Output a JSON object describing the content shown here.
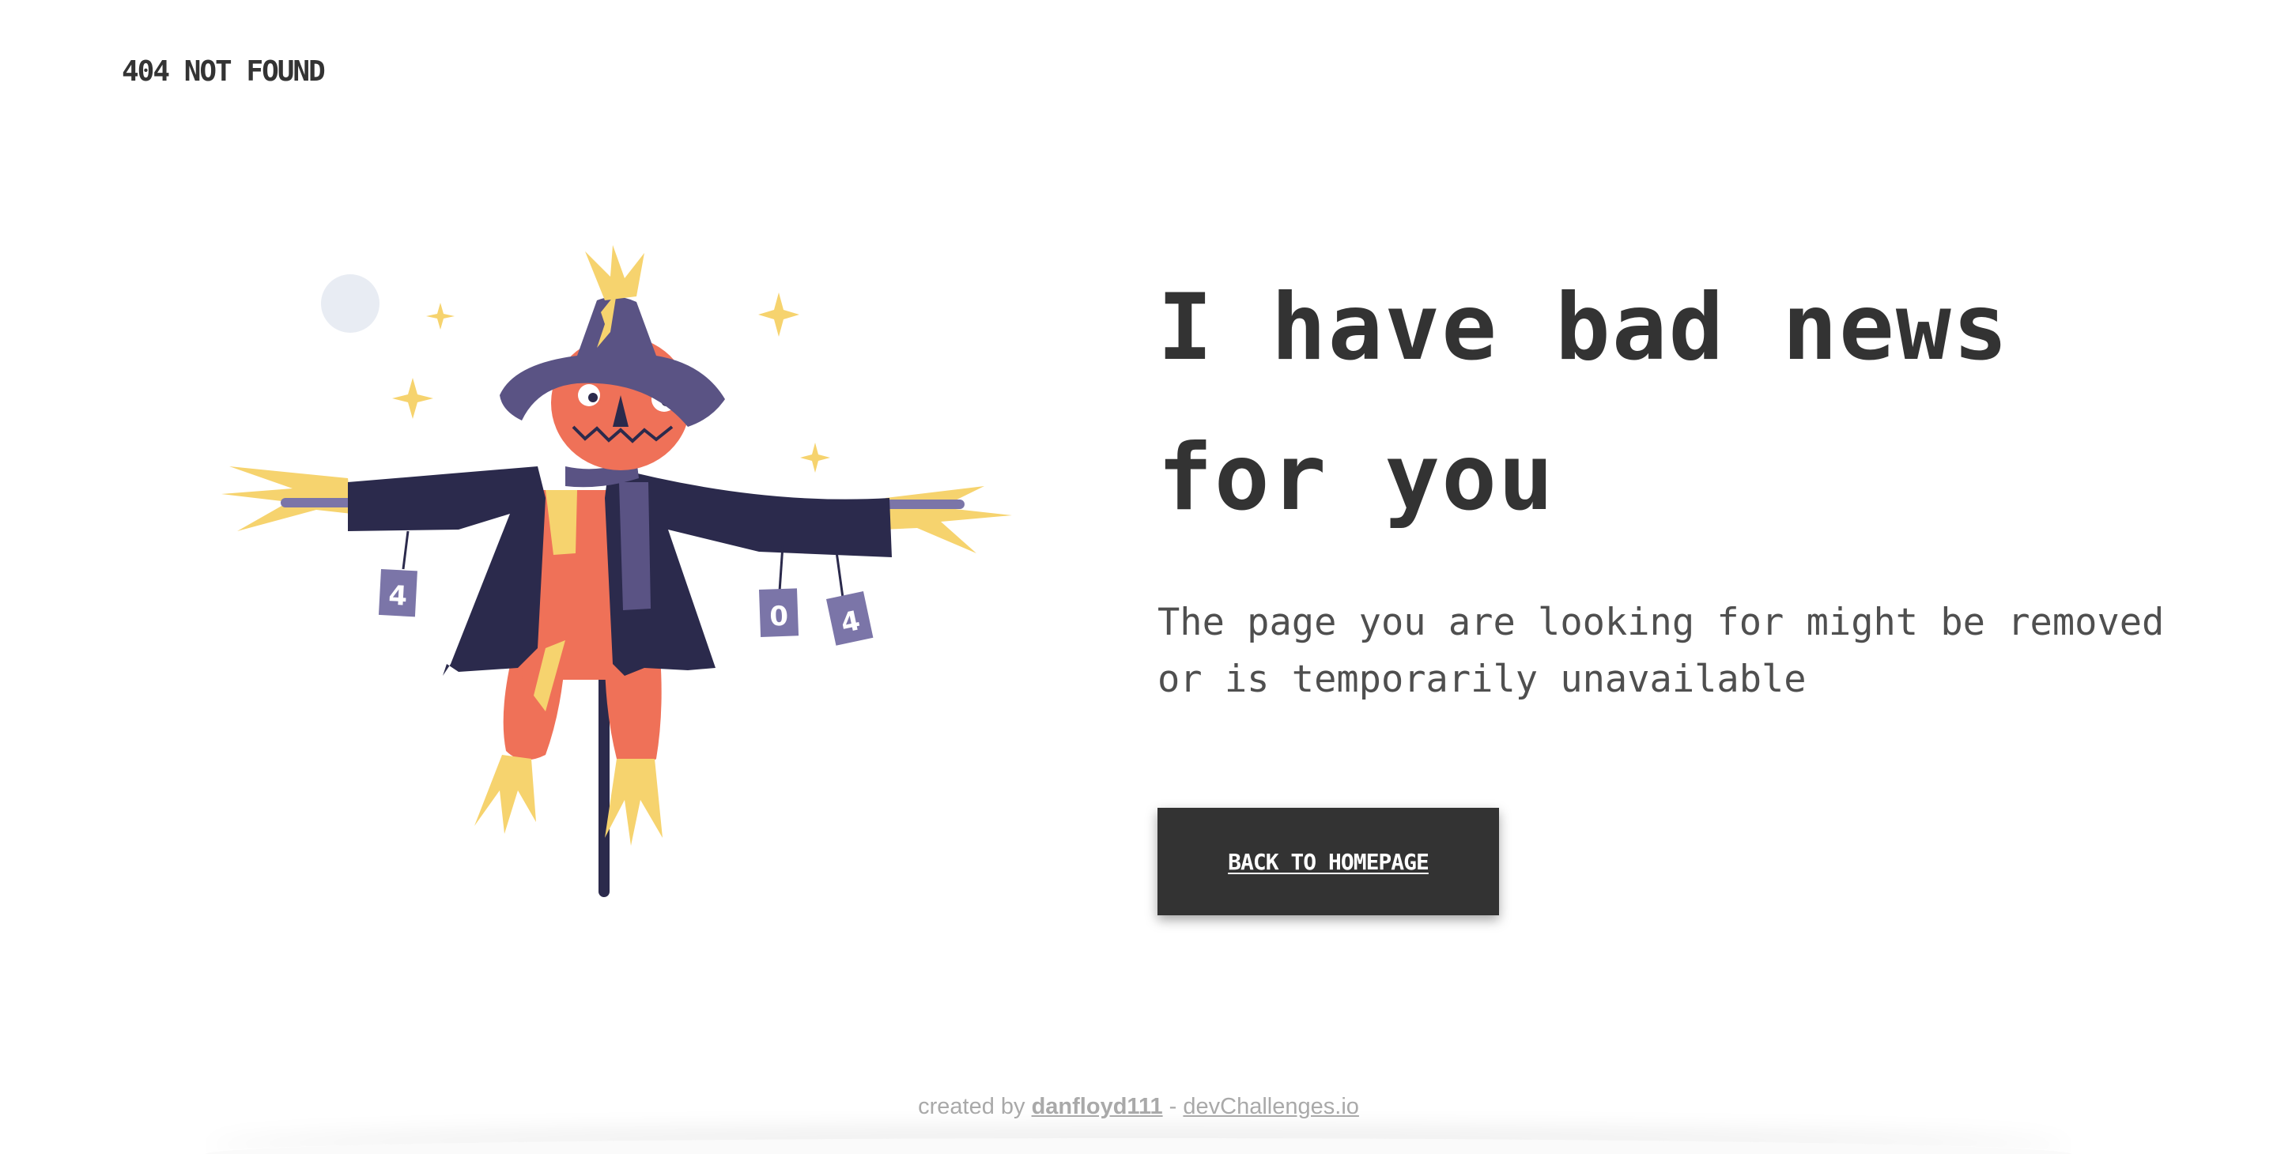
{
  "brand": {
    "label": "404 NOT FOUND"
  },
  "main": {
    "headline": "I have bad news for you",
    "message": "The page you are looking for might be removed or is temporarily unavailable",
    "button_label": "BACK TO HOMEPAGE"
  },
  "illustration": {
    "can_labels": [
      "4",
      "0",
      "4"
    ]
  },
  "footer": {
    "prefix": "created by",
    "author": "danfloyd111",
    "separator": "-",
    "site": "devChallenges.io"
  },
  "colors": {
    "text": "#333333",
    "button_bg": "#333333",
    "coat": "#2b2a4c",
    "hat": "#5a5384",
    "face": "#ef7158",
    "straw": "#f6d36e",
    "can": "#7b75a8",
    "moon": "#e8ecf3"
  }
}
